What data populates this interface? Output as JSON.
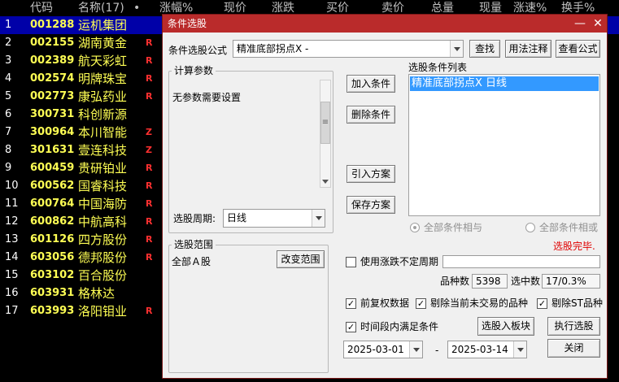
{
  "table": {
    "headers": [
      {
        "label": "代码"
      },
      {
        "label": "名称(17)"
      },
      {
        "label": "•"
      },
      {
        "label": "涨幅%"
      },
      {
        "label": "现价"
      },
      {
        "label": "涨跌"
      },
      {
        "label": "买价"
      },
      {
        "label": "卖价"
      },
      {
        "label": "总量"
      },
      {
        "label": "现量"
      },
      {
        "label": "涨速%"
      },
      {
        "label": "换手%"
      }
    ],
    "rows": [
      {
        "idx": "1",
        "code": "001288",
        "name": "运机集团",
        "flag": ""
      },
      {
        "idx": "2",
        "code": "002155",
        "name": "湖南黄金",
        "flag": "R"
      },
      {
        "idx": "3",
        "code": "002389",
        "name": "航天彩虹",
        "flag": "R"
      },
      {
        "idx": "4",
        "code": "002574",
        "name": "明牌珠宝",
        "flag": "R"
      },
      {
        "idx": "5",
        "code": "002773",
        "name": "康弘药业",
        "flag": "R"
      },
      {
        "idx": "6",
        "code": "300731",
        "name": "科创新源",
        "flag": ""
      },
      {
        "idx": "7",
        "code": "300964",
        "name": "本川智能",
        "flag": "Z"
      },
      {
        "idx": "8",
        "code": "301631",
        "name": "壹连科技",
        "flag": "Z"
      },
      {
        "idx": "9",
        "code": "600459",
        "name": "贵研铂业",
        "flag": "R"
      },
      {
        "idx": "10",
        "code": "600562",
        "name": "国睿科技",
        "flag": "R"
      },
      {
        "idx": "11",
        "code": "600764",
        "name": "中国海防",
        "flag": "R"
      },
      {
        "idx": "12",
        "code": "600862",
        "name": "中航高科",
        "flag": "R"
      },
      {
        "idx": "13",
        "code": "601126",
        "name": "四方股份",
        "flag": "R"
      },
      {
        "idx": "14",
        "code": "603056",
        "name": "德邦股份",
        "flag": "R"
      },
      {
        "idx": "15",
        "code": "603102",
        "name": "百合股份",
        "flag": ""
      },
      {
        "idx": "16",
        "code": "603931",
        "name": "格林达",
        "flag": ""
      },
      {
        "idx": "17",
        "code": "603993",
        "name": "洛阳钼业",
        "flag": "R"
      }
    ]
  },
  "dialog": {
    "title": "条件选股",
    "formula_label": "条件选股公式",
    "formula_value": "精准底部拐点X -",
    "find_button": "查找",
    "usage_button": "用法注释",
    "view_formula_button": "查看公式",
    "params_group": "计算参数",
    "params_text": "无参数需要设置",
    "period_label": "选股周期:",
    "period_value": "日线",
    "range_group": "选股范围",
    "range_text": "全部Ａ股",
    "change_range_button": "改变范围",
    "add_condition_button": "加入条件",
    "delete_condition_button": "删除条件",
    "import_plan_button": "引入方案",
    "save_plan_button": "保存方案",
    "condition_list_label": "选股条件列表",
    "condition_items": [
      "精准底部拐点X  日线"
    ],
    "radio_and": "全部条件相与",
    "radio_or": "全部条件相或",
    "status": "选股完毕.",
    "use_period_label": "使用涨跌不定周期",
    "use_period_value": "",
    "count_label": "品种数",
    "count_value": "5398",
    "selected_label": "选中数",
    "selected_value": "17/0.3%",
    "pre_adjust_label": "前复权数据",
    "exclude_untraded_label": "剔除当前未交易的品种",
    "exclude_st_label": "剔除ST品种",
    "time_range_label": "时间段内满足条件",
    "to_board_button": "选股入板块",
    "execute_button": "执行选股",
    "date_from": "2025-03-01",
    "date_sep": "-",
    "date_to": "2025-03-14",
    "close_button": "关闭",
    "checkbox_mark": "✓",
    "minimize_glyph": "—",
    "close_glyph": "✕",
    "scroll_grip": "≡"
  },
  "colors": {
    "title_bar": "#ba2b2b",
    "selection": "#3399ff",
    "status_text": "#e00000",
    "stock_code": "#ffff54",
    "flag_red": "#ff3030"
  }
}
